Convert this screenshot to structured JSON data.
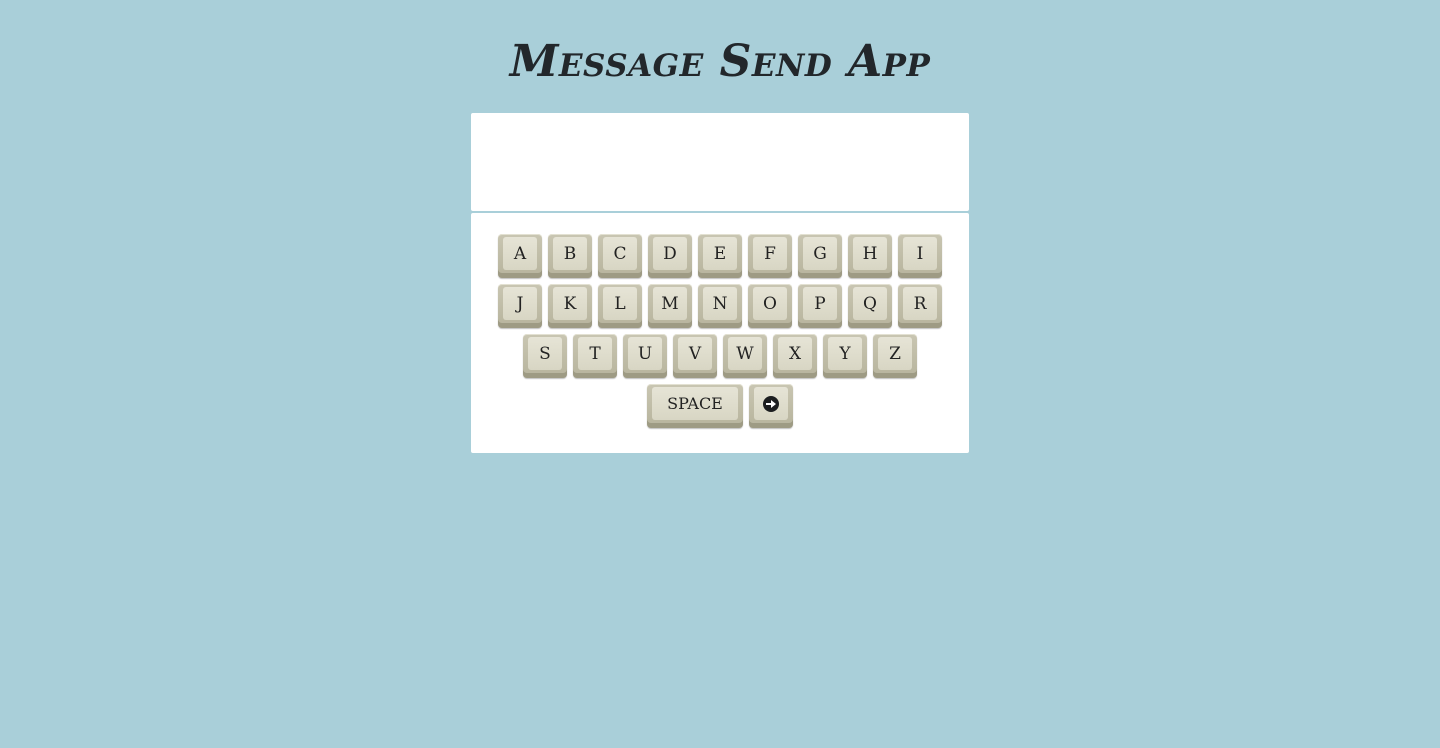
{
  "app": {
    "title": "Message Send App"
  },
  "message": {
    "text": ""
  },
  "keyboard": {
    "row1": [
      "A",
      "B",
      "C",
      "D",
      "E",
      "F",
      "G",
      "H",
      "I"
    ],
    "row2": [
      "J",
      "K",
      "L",
      "M",
      "N",
      "O",
      "P",
      "Q",
      "R"
    ],
    "row3": [
      "S",
      "T",
      "U",
      "V",
      "W",
      "X",
      "Y",
      "Z"
    ],
    "space_label": "SPACE",
    "send_icon": "arrow-circle-right-icon"
  },
  "colors": {
    "background": "#a9cfd9",
    "panel": "#ffffff",
    "key": "#d8d6c4",
    "text": "#22272b"
  }
}
